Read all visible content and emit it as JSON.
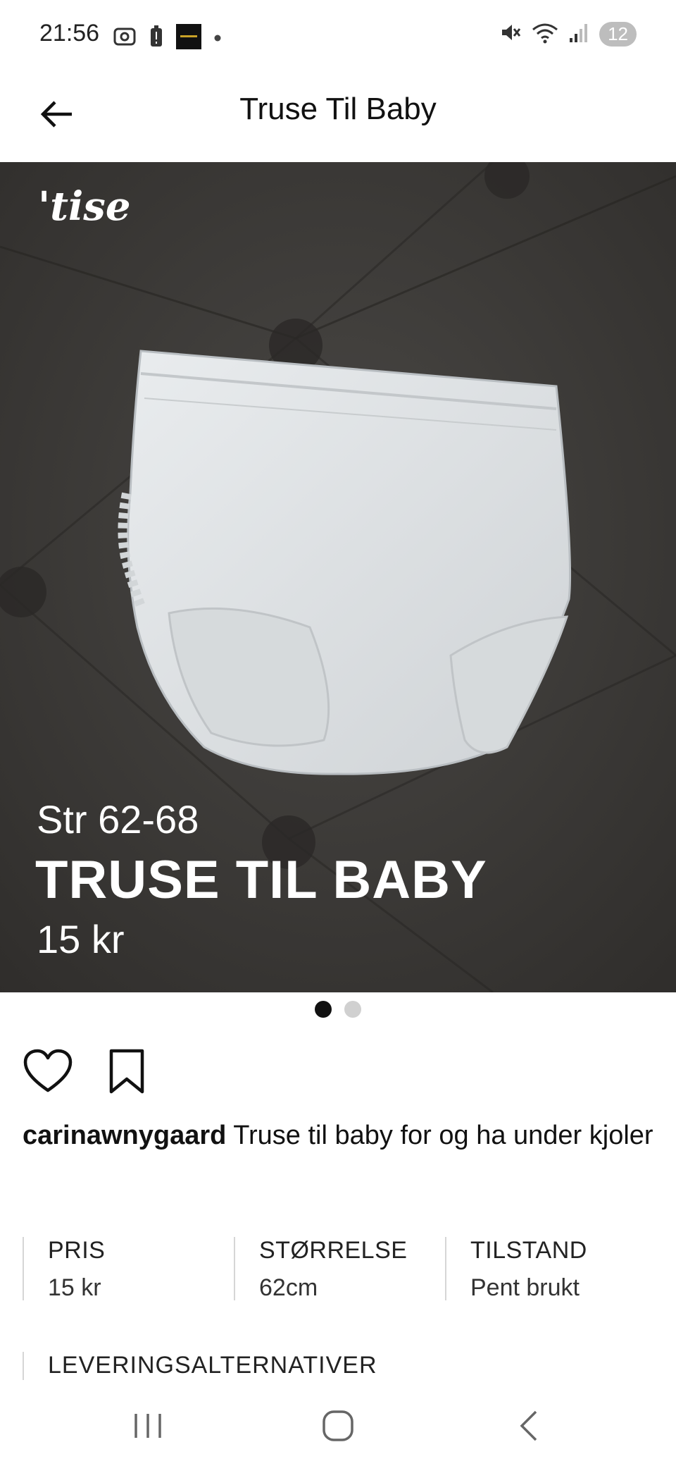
{
  "status_bar": {
    "time": "21:56",
    "notification_badge": "12",
    "icons_left": [
      "screenshot-icon",
      "battery-alert-icon",
      "app-thumbnail-icon",
      "dot-icon"
    ],
    "icons_right": [
      "mute-icon",
      "wifi-icon",
      "signal-icon"
    ]
  },
  "app_bar": {
    "title": "Truse Til Baby",
    "back_icon": "arrow-left-icon"
  },
  "hero": {
    "brand": "'tise",
    "overlay_size": "Str 62-68",
    "overlay_title": "TRUSE TIL BABY",
    "overlay_price": "15 kr",
    "image_count": 2,
    "active_image": 1
  },
  "actions": {
    "like_icon": "heart-icon",
    "save_icon": "bookmark-icon"
  },
  "description": {
    "username": "carinawnygaard",
    "text": "Truse til baby for og ha under kjoler"
  },
  "specs": [
    {
      "label": "PRIS",
      "value": "15 kr"
    },
    {
      "label": "STØRRELSE",
      "value": "62cm"
    },
    {
      "label": "TILSTAND",
      "value": "Pent brukt"
    }
  ],
  "delivery": {
    "label": "LEVERINGSALTERNATIVER"
  },
  "nav_bar": {
    "buttons": [
      "recents-icon",
      "home-icon",
      "back-icon"
    ]
  },
  "colors": {
    "background": "#ffffff",
    "hero_background": "#3c3a38",
    "text": "#111111",
    "divider": "#d6d6d6"
  }
}
